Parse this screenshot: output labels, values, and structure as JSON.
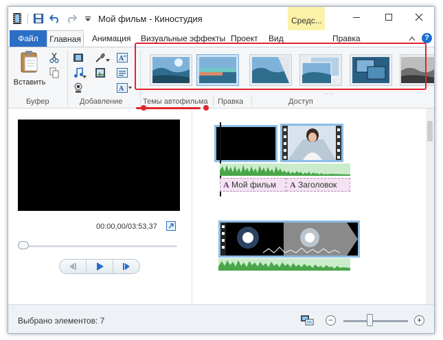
{
  "window": {
    "title": "Мой фильм - Киностудия",
    "context_tab_group": "Средс..."
  },
  "quick_access": {
    "icons": [
      "film-icon",
      "save-icon",
      "undo-icon",
      "redo-icon",
      "customize-dropdown-icon"
    ]
  },
  "window_controls": {
    "minimize": "—",
    "maximize": "☐",
    "close": "✕"
  },
  "tabs": [
    {
      "label": "Файл",
      "active": false
    },
    {
      "label": "Главная",
      "active": true
    },
    {
      "label": "Анимация",
      "active": false
    },
    {
      "label": "Визуальные эффекты",
      "active": false
    },
    {
      "label": "Проект",
      "active": false
    },
    {
      "label": "Вид",
      "active": false
    },
    {
      "label": "Правка",
      "active": false
    }
  ],
  "ribbon": {
    "clipboard": {
      "paste_label": "Вставить",
      "group_label": "Буфер"
    },
    "add": {
      "group_label": "Добавление"
    },
    "themes": {
      "group_label": "Темы автофильма",
      "items": [
        {
          "name": "theme-default",
          "selected": false
        },
        {
          "name": "theme-contemporary",
          "selected": true
        },
        {
          "name": "theme-fade",
          "selected": false
        },
        {
          "name": "theme-pan-zoom",
          "selected": false
        },
        {
          "name": "theme-cinematic",
          "selected": false
        },
        {
          "name": "theme-black-white",
          "selected": false
        }
      ],
      "grip": "....",
      "highlight_color": "#e3242b"
    },
    "edit": {
      "group_label": "Правка"
    },
    "share": {
      "group_label": "Доступ"
    }
  },
  "preview": {
    "timecode": "00:00,00/03:53,37",
    "seek_position": 0.0
  },
  "storyboard": {
    "captions": [
      {
        "glyph": "A",
        "text": "Мой фильм"
      },
      {
        "glyph": "A",
        "text": "Заголовок"
      }
    ]
  },
  "status": {
    "selected_text": "Выбрано элементов: 7",
    "zoom_level": 0.4
  },
  "colors": {
    "file_tab": "#2b6ec5",
    "context_tab": "#fbf2a7",
    "accent_red": "#e3242b",
    "clip_border": "#8bbce6",
    "audio_wave": "#4aa64a"
  }
}
